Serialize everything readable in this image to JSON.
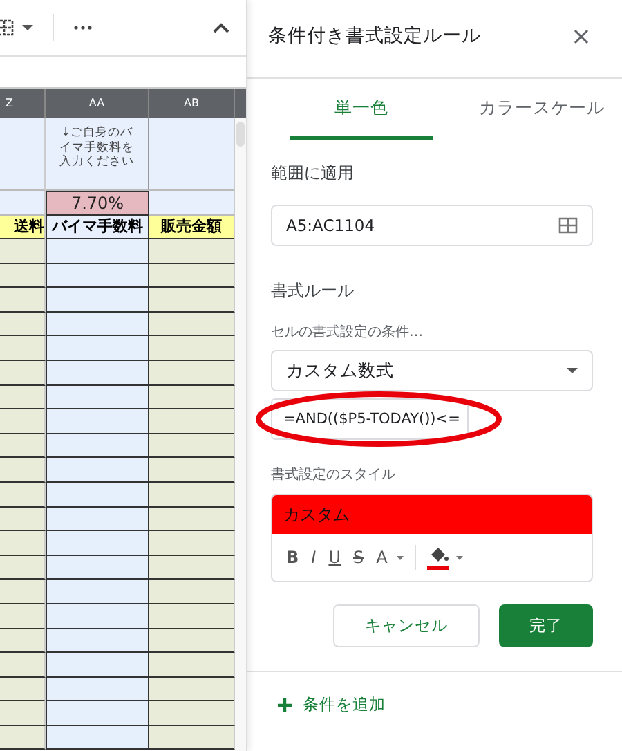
{
  "sheet": {
    "columns": [
      {
        "label": "Z"
      },
      {
        "label": "AA"
      },
      {
        "label": "AB"
      }
    ],
    "note": "↓ご自身のバイマ手数料を入力ください",
    "rate": "7.70%",
    "headers": [
      "送料",
      "バイマ手数料",
      "販売金額"
    ]
  },
  "panel": {
    "title": "条件付き書式設定ルール",
    "tabs": [
      {
        "label": "単一色",
        "selected": true
      },
      {
        "label": "カラースケール",
        "selected": false
      }
    ],
    "range_label": "範囲に適用",
    "range_value": "A5:AC1104",
    "rules_heading": "書式ルール",
    "condition_label": "セルの書式設定の条件…",
    "condition_value": "カスタム数式",
    "formula_value": "=AND(($P5-TODAY())<=",
    "style_label": "書式設定のスタイル",
    "style_preview": "カスタム",
    "style_tools": [
      {
        "kind": "text",
        "label": "B"
      },
      {
        "kind": "text",
        "label": "I"
      },
      {
        "kind": "text",
        "label": "U"
      },
      {
        "kind": "text",
        "label": "S"
      },
      {
        "kind": "text",
        "label": "A"
      },
      {
        "kind": "fill"
      }
    ],
    "buttons": [
      {
        "label": "キャンセル",
        "kind": "secondary"
      },
      {
        "label": "完了",
        "kind": "primary"
      }
    ],
    "add_rule": "条件を追加"
  }
}
